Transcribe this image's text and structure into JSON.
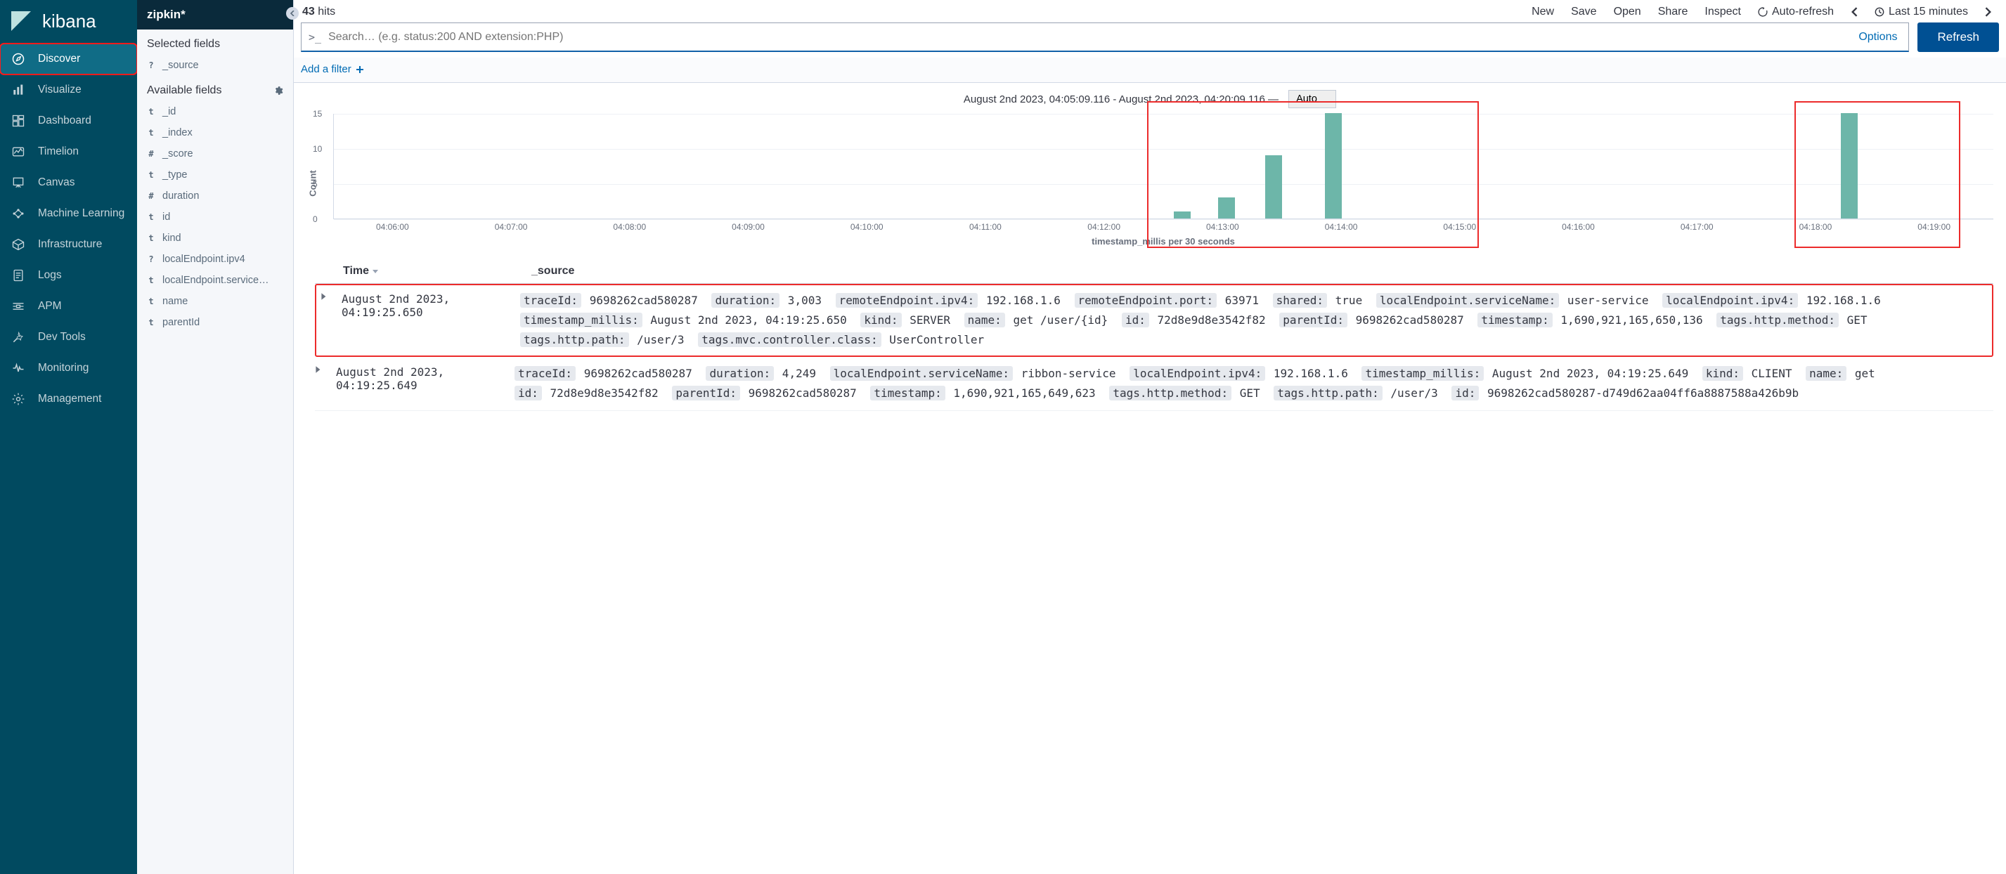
{
  "brand": "kibana",
  "nav": [
    {
      "id": "discover",
      "label": "Discover",
      "active": true,
      "hl": true
    },
    {
      "id": "visualize",
      "label": "Visualize"
    },
    {
      "id": "dashboard",
      "label": "Dashboard"
    },
    {
      "id": "timelion",
      "label": "Timelion"
    },
    {
      "id": "canvas",
      "label": "Canvas"
    },
    {
      "id": "ml",
      "label": "Machine Learning"
    },
    {
      "id": "infrastructure",
      "label": "Infrastructure"
    },
    {
      "id": "logs",
      "label": "Logs"
    },
    {
      "id": "apm",
      "label": "APM"
    },
    {
      "id": "devtools",
      "label": "Dev Tools"
    },
    {
      "id": "monitoring",
      "label": "Monitoring"
    },
    {
      "id": "management",
      "label": "Management"
    }
  ],
  "hits_count": "43",
  "hits_label": "hits",
  "topbar": {
    "new": "New",
    "save": "Save",
    "open": "Open",
    "share": "Share",
    "inspect": "Inspect",
    "autorefresh": "Auto-refresh",
    "timerange": "Last 15 minutes"
  },
  "search": {
    "prompt": ">_",
    "placeholder": "Search… (e.g. status:200 AND extension:PHP)",
    "options": "Options",
    "refresh": "Refresh"
  },
  "add_filter": "Add a filter",
  "index_pattern": "zipkin*",
  "selected_fields_label": "Selected fields",
  "selected_fields": [
    {
      "type": "?",
      "name": "_source"
    }
  ],
  "available_fields_label": "Available fields",
  "available_fields": [
    {
      "type": "t",
      "name": "_id"
    },
    {
      "type": "t",
      "name": "_index"
    },
    {
      "type": "#",
      "name": "_score"
    },
    {
      "type": "t",
      "name": "_type"
    },
    {
      "type": "#",
      "name": "duration"
    },
    {
      "type": "t",
      "name": "id"
    },
    {
      "type": "t",
      "name": "kind"
    },
    {
      "type": "?",
      "name": "localEndpoint.ipv4"
    },
    {
      "type": "t",
      "name": "localEndpoint.service…"
    },
    {
      "type": "t",
      "name": "name"
    },
    {
      "type": "t",
      "name": "parentId"
    }
  ],
  "chart_header": {
    "range": "August 2nd 2023, 04:05:09.116 - August 2nd 2023, 04:20:09.116 —",
    "interval": "Auto"
  },
  "chart_data": {
    "type": "bar",
    "ylabel": "Count",
    "xlabel": "timestamp_millis per 30 seconds",
    "ylim": [
      0,
      15
    ],
    "yticks": [
      0,
      5,
      10,
      15
    ],
    "xticks": [
      "04:06:00",
      "04:07:00",
      "04:08:00",
      "04:09:00",
      "04:10:00",
      "04:11:00",
      "04:12:00",
      "04:13:00",
      "04:14:00",
      "04:15:00",
      "04:16:00",
      "04:17:00",
      "04:18:00",
      "04:19:00"
    ],
    "bars": [
      {
        "x_pct": 50.6,
        "value": 1
      },
      {
        "x_pct": 53.3,
        "value": 3
      },
      {
        "x_pct": 56.1,
        "value": 9
      },
      {
        "x_pct": 59.7,
        "value": 15
      },
      {
        "x_pct": 90.8,
        "value": 15
      }
    ],
    "highlights": [
      {
        "left_pct": 49.0,
        "width_pct": 20.0
      },
      {
        "left_pct": 88.0,
        "width_pct": 10.0
      }
    ]
  },
  "docs_head": {
    "time": "Time",
    "source": "_source"
  },
  "docs": [
    {
      "hl": true,
      "time": "August 2nd 2023, 04:19:25.650",
      "kv": [
        {
          "k": "traceId:",
          "v": "9698262cad580287"
        },
        {
          "k": "duration:",
          "v": "3,003"
        },
        {
          "k": "remoteEndpoint.ipv4:",
          "v": "192.168.1.6"
        },
        {
          "k": "remoteEndpoint.port:",
          "v": "63971"
        },
        {
          "k": "shared:",
          "v": "true"
        },
        {
          "k": "localEndpoint.serviceName:",
          "v": "user-service"
        },
        {
          "k": "localEndpoint.ipv4:",
          "v": "192.168.1.6"
        },
        {
          "k": "timestamp_millis:",
          "v": "August 2nd 2023, 04:19:25.650"
        },
        {
          "k": "kind:",
          "v": "SERVER"
        },
        {
          "k": "name:",
          "v": "get /user/{id}"
        },
        {
          "k": "id:",
          "v": "72d8e9d8e3542f82"
        },
        {
          "k": "parentId:",
          "v": "9698262cad580287"
        },
        {
          "k": "timestamp:",
          "v": "1,690,921,165,650,136"
        },
        {
          "k": "tags.http.method:",
          "v": "GET"
        },
        {
          "k": "tags.http.path:",
          "v": "/user/3"
        },
        {
          "k": "tags.mvc.controller.class:",
          "v": "UserController"
        }
      ]
    },
    {
      "hl": false,
      "time": "August 2nd 2023, 04:19:25.649",
      "kv": [
        {
          "k": "traceId:",
          "v": "9698262cad580287"
        },
        {
          "k": "duration:",
          "v": "4,249"
        },
        {
          "k": "localEndpoint.serviceName:",
          "v": "ribbon-service"
        },
        {
          "k": "localEndpoint.ipv4:",
          "v": "192.168.1.6"
        },
        {
          "k": "timestamp_millis:",
          "v": "August 2nd 2023, 04:19:25.649"
        },
        {
          "k": "kind:",
          "v": "CLIENT"
        },
        {
          "k": "name:",
          "v": "get"
        },
        {
          "k": "id:",
          "v": "72d8e9d8e3542f82"
        },
        {
          "k": "parentId:",
          "v": "9698262cad580287"
        },
        {
          "k": "timestamp:",
          "v": "1,690,921,165,649,623"
        },
        {
          "k": "tags.http.method:",
          "v": "GET"
        },
        {
          "k": "tags.http.path:",
          "v": "/user/3"
        },
        {
          "k": "id:",
          "v": "9698262cad580287-d749d62aa04ff6a8887588a426b9b"
        }
      ]
    }
  ]
}
